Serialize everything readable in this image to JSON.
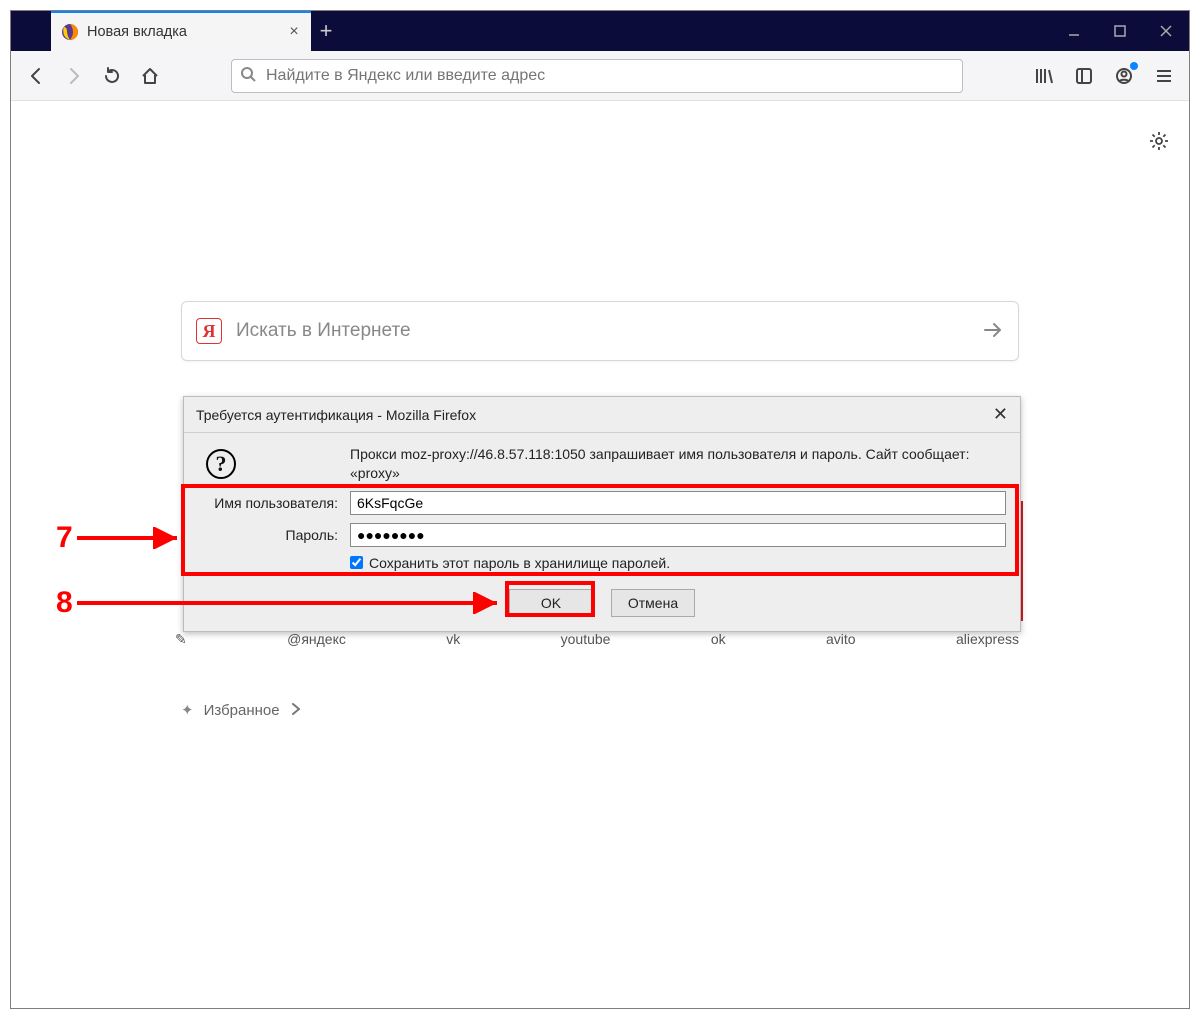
{
  "tabbar": {
    "active_tab_title": "Новая вкладка"
  },
  "toolbar": {
    "url_placeholder": "Найдите в Яндекс или введите адрес"
  },
  "newtab": {
    "search_placeholder": "Искать в Интернете",
    "topsites": [
      "@яндекс",
      "vk",
      "youtube",
      "ok",
      "avito",
      "aliexpress"
    ],
    "favorites_label": "Избранное"
  },
  "dialog": {
    "title": "Требуется аутентификация - Mozilla Firefox",
    "message": "Прокси moz-proxy://46.8.57.118:1050 запрашивает имя пользователя и пароль. Сайт сообщает: «proxy»",
    "username_label": "Имя пользователя:",
    "username_value": "6KsFqcGe",
    "password_label": "Пароль:",
    "password_value": "●●●●●●●●",
    "save_label": "Сохранить этот пароль в хранилище паролей.",
    "ok_label": "OK",
    "cancel_label": "Отмена"
  },
  "annotations": {
    "n7": "7",
    "n8": "8"
  }
}
